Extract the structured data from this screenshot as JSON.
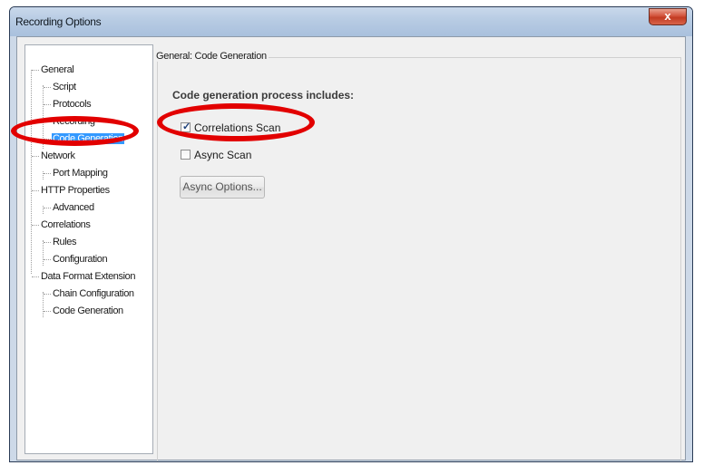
{
  "window": {
    "title": "Recording Options",
    "close_label": "x"
  },
  "tree": {
    "items": [
      {
        "label": "General",
        "level": 0
      },
      {
        "label": "Script",
        "level": 1
      },
      {
        "label": "Protocols",
        "level": 1
      },
      {
        "label": "Recording",
        "level": 1
      },
      {
        "label": "Code Generation",
        "level": 1,
        "selected": true
      },
      {
        "label": "Network",
        "level": 0
      },
      {
        "label": "Port Mapping",
        "level": 1
      },
      {
        "label": "HTTP Properties",
        "level": 0
      },
      {
        "label": "Advanced",
        "level": 1
      },
      {
        "label": "Correlations",
        "level": 0
      },
      {
        "label": "Rules",
        "level": 1
      },
      {
        "label": "Configuration",
        "level": 1
      },
      {
        "label": "Data Format Extension",
        "level": 0
      },
      {
        "label": "Chain Configuration",
        "level": 1
      },
      {
        "label": "Code Generation",
        "level": 1
      }
    ]
  },
  "panel": {
    "group_title": "General: Code Generation",
    "section_label": "Code generation process includes:",
    "correlations_scan": {
      "label": "Correlations Scan",
      "checked": true
    },
    "async_scan": {
      "label": "Async Scan",
      "checked": false
    },
    "async_options_label": "Async Options..."
  },
  "annotations": {
    "color": "#e20000"
  }
}
